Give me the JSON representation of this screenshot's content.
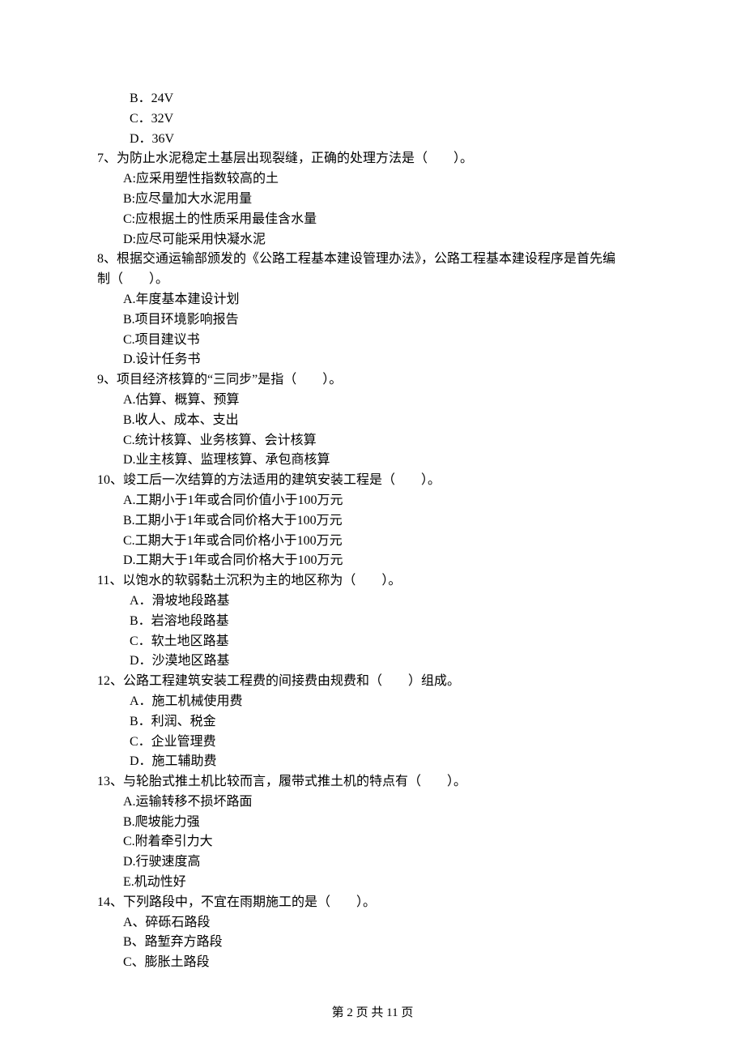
{
  "q6_options": {
    "B": "B．24V",
    "C": "C．32V",
    "D": "D．36V"
  },
  "q7": {
    "text": "7、为防止水泥稳定土基层出现裂缝，正确的处理方法是（　　）。",
    "A": "A:应采用塑性指数较高的土",
    "B": "B:应尽量加大水泥用量",
    "C": "C:应根据土的性质采用最佳含水量",
    "D": "D:应尽可能采用快凝水泥"
  },
  "q8": {
    "text_line1": "8、根据交通运输部颁发的《公路工程基本建设管理办法》，公路工程基本建设程序是首先编",
    "text_line2": "制（　　）。",
    "A": "A.年度基本建设计划",
    "B": "B.项目环境影响报告",
    "C": "C.项目建议书",
    "D": "D.设计任务书"
  },
  "q9": {
    "text": "9、项目经济核算的“三同步”是指（　　）。",
    "A": "A.估算、概算、预算",
    "B": "B.收人、成本、支出",
    "C": "C.统计核算、业务核算、会计核算",
    "D": "D.业主核算、监理核算、承包商核算"
  },
  "q10": {
    "text": "10、竣工后一次结算的方法适用的建筑安装工程是（　　）。",
    "A": "A.工期小于1年或合同价值小于100万元",
    "B": "B.工期小于1年或合同价格大于100万元",
    "C": "C.工期大于1年或合同价格小于100万元",
    "D": "D.工期大于1年或合同价格大于100万元"
  },
  "q11": {
    "text": "11、以饱水的软弱黏土沉积为主的地区称为（　　）。",
    "A": "A．滑坡地段路基",
    "B": "B．岩溶地段路基",
    "C": "C．软土地区路基",
    "D": "D．沙漠地区路基"
  },
  "q12": {
    "text": "12、公路工程建筑安装工程费的间接费由规费和（　　）组成。",
    "A": "A．施工机械使用费",
    "B": "B．利润、税金",
    "C": "C．企业管理费",
    "D": "D．施工辅助费"
  },
  "q13": {
    "text": "13、与轮胎式推土机比较而言，履带式推土机的特点有（　　）。",
    "A": "A.运输转移不损坏路面",
    "B": "B.爬坡能力强",
    "C": "C.附着牵引力大",
    "D": "D.行驶速度高",
    "E": "E.机动性好"
  },
  "q14": {
    "text": "14、下列路段中，不宜在雨期施工的是（　　）。",
    "A": "A、碎砾石路段",
    "B": "B、路堑弃方路段",
    "C": "C、膨胀土路段"
  },
  "footer": "第 2 页 共 11 页"
}
